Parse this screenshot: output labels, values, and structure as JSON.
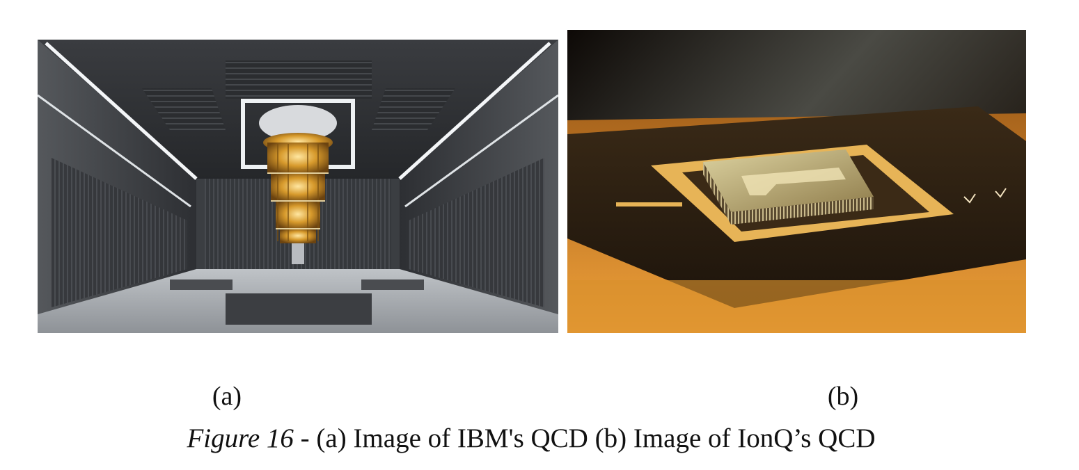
{
  "figure": {
    "label_a": "(a)",
    "label_b": "(b)",
    "caption_prefix": "Figure 16",
    "caption_text": " - (a) Image of IBM's QCD (b) Image of IonQ’s QCD"
  },
  "photos": {
    "a": {
      "icon": "quantum-computer-room-photo"
    },
    "b": {
      "icon": "ion-trap-chip-photo"
    }
  }
}
